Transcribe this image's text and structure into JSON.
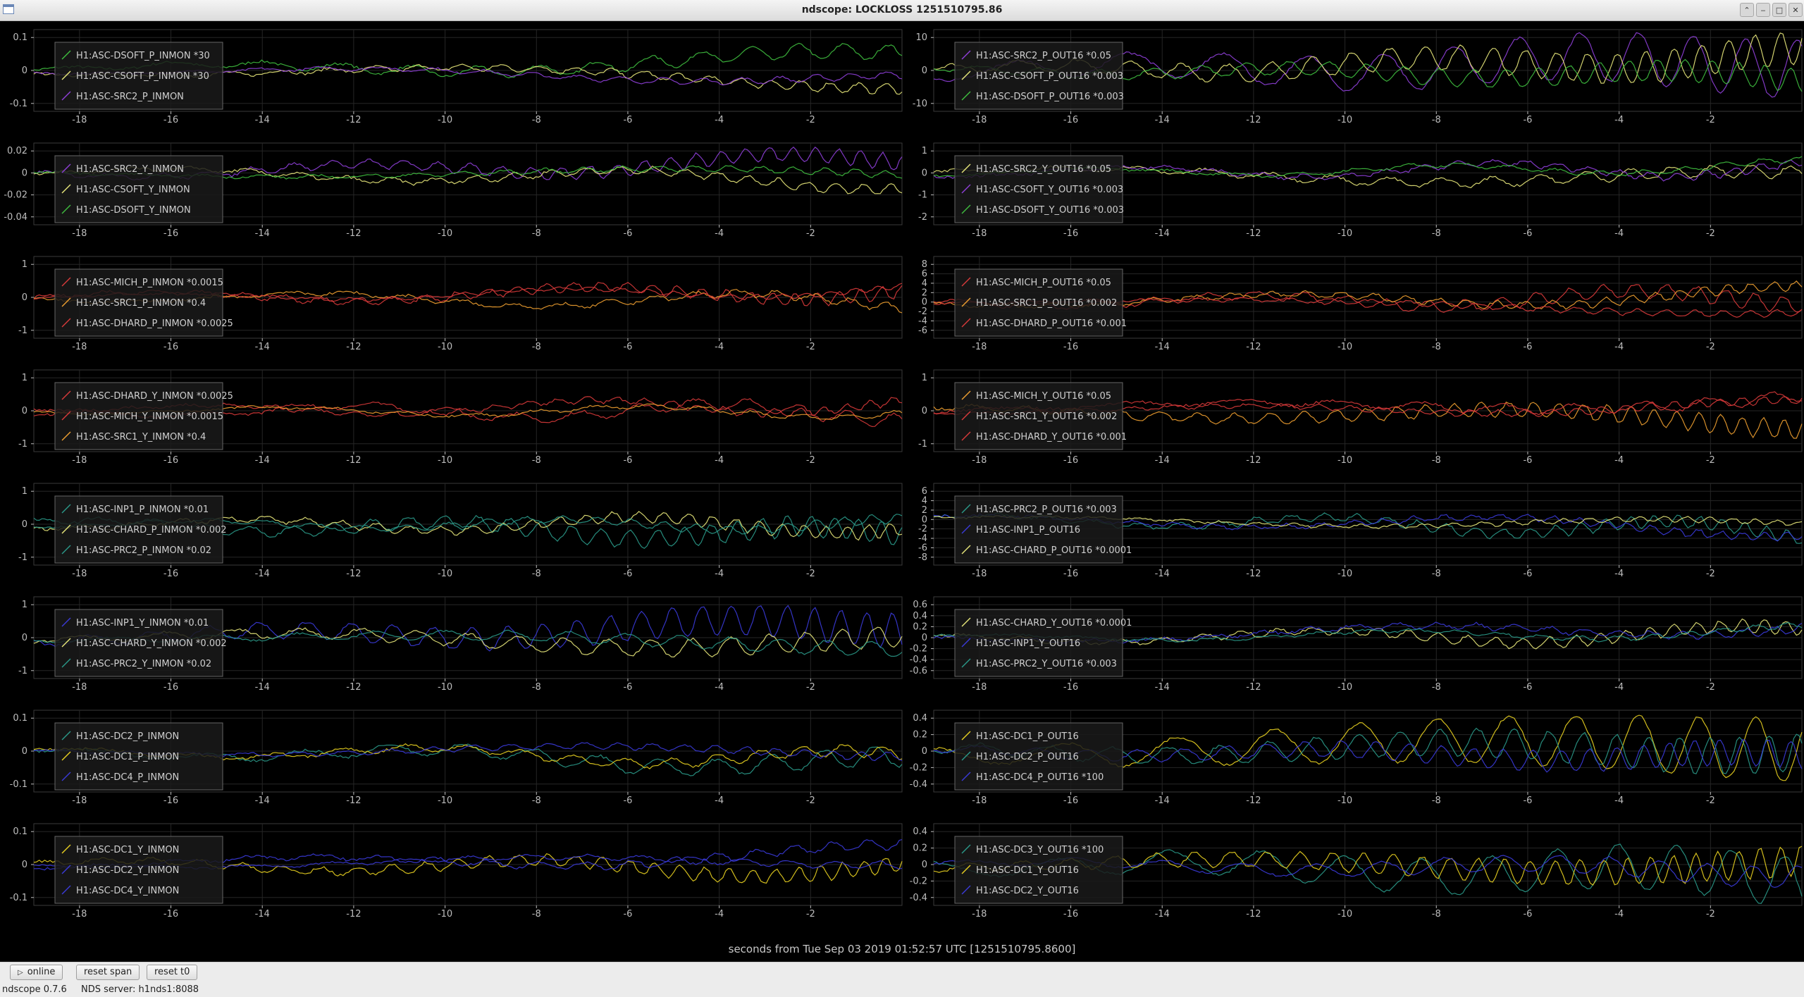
{
  "window": {
    "title": "ndscope: LOCKLOSS 1251510795.86"
  },
  "colors": {
    "background": "#000000",
    "grid": "#262626",
    "tick": "#bdbdbd",
    "palette": [
      "#3fbf3f",
      "#e8e87a",
      "#8f3fd9",
      "#d93a3a",
      "#f0a030",
      "#3a3ad9",
      "#2a9a8a",
      "#e8d020"
    ]
  },
  "x_axis": {
    "label": "seconds from Tue Sep 03 2019 01:52:57 UTC [1251510795.8600]",
    "ticks": [
      "-18",
      "-16",
      "-14",
      "-12",
      "-10",
      "-8",
      "-6",
      "-4",
      "-2"
    ]
  },
  "panels": [
    {
      "yticks": [
        "0.1",
        "0",
        "-0.1"
      ],
      "channels": [
        "H1:ASC-DSOFT_P_INMON *30",
        "H1:ASC-CSOFT_P_INMON *30",
        "H1:ASC-SRC2_P_INMON"
      ]
    },
    {
      "yticks": [
        "10",
        "0",
        "-10"
      ],
      "channels": [
        "H1:ASC-SRC2_P_OUT16 *0.05",
        "H1:ASC-CSOFT_P_OUT16 *0.003",
        "H1:ASC-DSOFT_P_OUT16 *0.003"
      ]
    },
    {
      "yticks": [
        "0.02",
        "0",
        "-0.02",
        "-0.04"
      ],
      "channels": [
        "H1:ASC-SRC2_Y_INMON",
        "H1:ASC-CSOFT_Y_INMON",
        "H1:ASC-DSOFT_Y_INMON"
      ]
    },
    {
      "yticks": [
        "1",
        "0",
        "-1",
        "-2"
      ],
      "channels": [
        "H1:ASC-SRC2_Y_OUT16 *0.05",
        "H1:ASC-CSOFT_Y_OUT16 *0.003",
        "H1:ASC-DSOFT_Y_OUT16 *0.003"
      ]
    },
    {
      "yticks": [
        "1",
        "0",
        "-1"
      ],
      "channels": [
        "H1:ASC-MICH_P_INMON *0.0015",
        "H1:ASC-SRC1_P_INMON *0.4",
        "H1:ASC-DHARD_P_INMON *0.0025"
      ]
    },
    {
      "yticks": [
        "8",
        "6",
        "4",
        "2",
        "0",
        "-2",
        "-4",
        "-6"
      ],
      "channels": [
        "H1:ASC-MICH_P_OUT16 *0.05",
        "H1:ASC-SRC1_P_OUT16 *0.002",
        "H1:ASC-DHARD_P_OUT16 *0.001"
      ]
    },
    {
      "yticks": [
        "1",
        "0",
        "-1"
      ],
      "channels": [
        "H1:ASC-DHARD_Y_INMON *0.0025",
        "H1:ASC-MICH_Y_INMON *0.0015",
        "H1:ASC-SRC1_Y_INMON *0.4"
      ]
    },
    {
      "yticks": [
        "1",
        "0",
        "-1"
      ],
      "channels": [
        "H1:ASC-MICH_Y_OUT16 *0.05",
        "H1:ASC-SRC1_Y_OUT16 *0.002",
        "H1:ASC-DHARD_Y_OUT16 *0.001"
      ]
    },
    {
      "yticks": [
        "1",
        "0",
        "-1"
      ],
      "channels": [
        "H1:ASC-INP1_P_INMON *0.01",
        "H1:ASC-CHARD_P_INMON *0.002",
        "H1:ASC-PRC2_P_INMON *0.02"
      ]
    },
    {
      "yticks": [
        "6",
        "4",
        "2",
        "0",
        "-2",
        "-4",
        "-6",
        "-8"
      ],
      "channels": [
        "H1:ASC-PRC2_P_OUT16 *0.003",
        "H1:ASC-INP1_P_OUT16",
        "H1:ASC-CHARD_P_OUT16 *0.0001"
      ]
    },
    {
      "yticks": [
        "1",
        "0",
        "-1"
      ],
      "channels": [
        "H1:ASC-INP1_Y_INMON *0.01",
        "H1:ASC-CHARD_Y_INMON *0.002",
        "H1:ASC-PRC2_Y_INMON *0.02"
      ]
    },
    {
      "yticks": [
        "0.6",
        "0.4",
        "0.2",
        "0",
        "-0.2",
        "-0.4",
        "-0.6"
      ],
      "channels": [
        "H1:ASC-CHARD_Y_OUT16 *0.0001",
        "H1:ASC-INP1_Y_OUT16",
        "H1:ASC-PRC2_Y_OUT16 *0.003"
      ]
    },
    {
      "yticks": [
        "0.1",
        "0",
        "-0.1"
      ],
      "channels": [
        "H1:ASC-DC2_P_INMON",
        "H1:ASC-DC1_P_INMON",
        "H1:ASC-DC4_P_INMON"
      ]
    },
    {
      "yticks": [
        "0.4",
        "0.2",
        "0",
        "-0.2",
        "-0.4"
      ],
      "channels": [
        "H1:ASC-DC1_P_OUT16",
        "H1:ASC-DC2_P_OUT16",
        "H1:ASC-DC4_P_OUT16 *100"
      ]
    },
    {
      "yticks": [
        "0.1",
        "0",
        "-0.1"
      ],
      "channels": [
        "H1:ASC-DC1_Y_INMON",
        "H1:ASC-DC2_Y_INMON",
        "H1:ASC-DC4_Y_INMON"
      ]
    },
    {
      "yticks": [
        "0.4",
        "0.2",
        "0",
        "-0.2",
        "-0.4"
      ],
      "channels": [
        "H1:ASC-DC3_Y_OUT16 *100",
        "H1:ASC-DC1_Y_OUT16",
        "H1:ASC-DC2_Y_OUT16"
      ]
    }
  ],
  "toolbar": {
    "online_label": "online",
    "reset_span_label": "reset span",
    "reset_t0_label": "reset t0"
  },
  "status": {
    "version": "ndscope 0.7.6",
    "server": "NDS server: h1nds1:8088"
  }
}
